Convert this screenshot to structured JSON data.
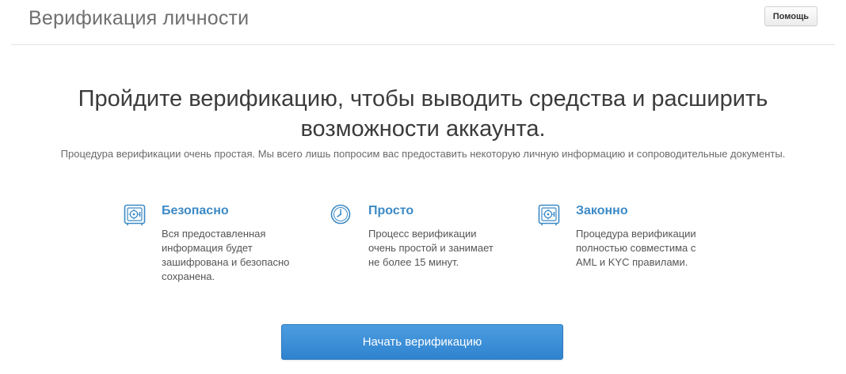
{
  "header": {
    "title": "Верификация личности",
    "help_label": "Помощь"
  },
  "hero": {
    "headline_line1": "Пройдите верификацию, чтобы выводить средства и расширить",
    "headline_line2": "возможности аккаунта.",
    "intro": "Процедура верификации очень простая. Мы всего лишь попросим вас предоставить некоторую личную информацию и сопроводительные документы."
  },
  "features": [
    {
      "icon": "safe-icon",
      "title": "Безопасно",
      "lines": [
        "Вся предоставленная",
        "информация будет",
        "зашифрована и безопасно",
        "сохранена."
      ]
    },
    {
      "icon": "clock-icon",
      "title": "Просто",
      "lines": [
        "Процесс верификации",
        "очень простой и занимает",
        "не более 15 минут."
      ]
    },
    {
      "icon": "safe-icon",
      "title": "Законно",
      "lines": [
        "Процедура верификации",
        "полностью совместима с",
        "AML и KYC правилами."
      ]
    }
  ],
  "cta": {
    "start_label": "Начать верификацию"
  },
  "colors": {
    "accent": "#3c8ac6",
    "button": "#2f83cf"
  }
}
